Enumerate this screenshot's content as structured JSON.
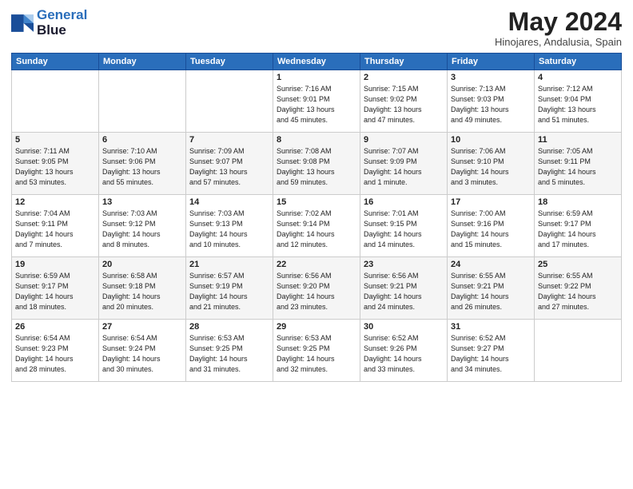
{
  "header": {
    "logo_line1": "General",
    "logo_line2": "Blue",
    "month": "May 2024",
    "location": "Hinojares, Andalusia, Spain"
  },
  "days_of_week": [
    "Sunday",
    "Monday",
    "Tuesday",
    "Wednesday",
    "Thursday",
    "Friday",
    "Saturday"
  ],
  "weeks": [
    [
      {
        "day": "",
        "info": ""
      },
      {
        "day": "",
        "info": ""
      },
      {
        "day": "",
        "info": ""
      },
      {
        "day": "1",
        "info": "Sunrise: 7:16 AM\nSunset: 9:01 PM\nDaylight: 13 hours\nand 45 minutes."
      },
      {
        "day": "2",
        "info": "Sunrise: 7:15 AM\nSunset: 9:02 PM\nDaylight: 13 hours\nand 47 minutes."
      },
      {
        "day": "3",
        "info": "Sunrise: 7:13 AM\nSunset: 9:03 PM\nDaylight: 13 hours\nand 49 minutes."
      },
      {
        "day": "4",
        "info": "Sunrise: 7:12 AM\nSunset: 9:04 PM\nDaylight: 13 hours\nand 51 minutes."
      }
    ],
    [
      {
        "day": "5",
        "info": "Sunrise: 7:11 AM\nSunset: 9:05 PM\nDaylight: 13 hours\nand 53 minutes."
      },
      {
        "day": "6",
        "info": "Sunrise: 7:10 AM\nSunset: 9:06 PM\nDaylight: 13 hours\nand 55 minutes."
      },
      {
        "day": "7",
        "info": "Sunrise: 7:09 AM\nSunset: 9:07 PM\nDaylight: 13 hours\nand 57 minutes."
      },
      {
        "day": "8",
        "info": "Sunrise: 7:08 AM\nSunset: 9:08 PM\nDaylight: 13 hours\nand 59 minutes."
      },
      {
        "day": "9",
        "info": "Sunrise: 7:07 AM\nSunset: 9:09 PM\nDaylight: 14 hours\nand 1 minute."
      },
      {
        "day": "10",
        "info": "Sunrise: 7:06 AM\nSunset: 9:10 PM\nDaylight: 14 hours\nand 3 minutes."
      },
      {
        "day": "11",
        "info": "Sunrise: 7:05 AM\nSunset: 9:11 PM\nDaylight: 14 hours\nand 5 minutes."
      }
    ],
    [
      {
        "day": "12",
        "info": "Sunrise: 7:04 AM\nSunset: 9:11 PM\nDaylight: 14 hours\nand 7 minutes."
      },
      {
        "day": "13",
        "info": "Sunrise: 7:03 AM\nSunset: 9:12 PM\nDaylight: 14 hours\nand 8 minutes."
      },
      {
        "day": "14",
        "info": "Sunrise: 7:03 AM\nSunset: 9:13 PM\nDaylight: 14 hours\nand 10 minutes."
      },
      {
        "day": "15",
        "info": "Sunrise: 7:02 AM\nSunset: 9:14 PM\nDaylight: 14 hours\nand 12 minutes."
      },
      {
        "day": "16",
        "info": "Sunrise: 7:01 AM\nSunset: 9:15 PM\nDaylight: 14 hours\nand 14 minutes."
      },
      {
        "day": "17",
        "info": "Sunrise: 7:00 AM\nSunset: 9:16 PM\nDaylight: 14 hours\nand 15 minutes."
      },
      {
        "day": "18",
        "info": "Sunrise: 6:59 AM\nSunset: 9:17 PM\nDaylight: 14 hours\nand 17 minutes."
      }
    ],
    [
      {
        "day": "19",
        "info": "Sunrise: 6:59 AM\nSunset: 9:17 PM\nDaylight: 14 hours\nand 18 minutes."
      },
      {
        "day": "20",
        "info": "Sunrise: 6:58 AM\nSunset: 9:18 PM\nDaylight: 14 hours\nand 20 minutes."
      },
      {
        "day": "21",
        "info": "Sunrise: 6:57 AM\nSunset: 9:19 PM\nDaylight: 14 hours\nand 21 minutes."
      },
      {
        "day": "22",
        "info": "Sunrise: 6:56 AM\nSunset: 9:20 PM\nDaylight: 14 hours\nand 23 minutes."
      },
      {
        "day": "23",
        "info": "Sunrise: 6:56 AM\nSunset: 9:21 PM\nDaylight: 14 hours\nand 24 minutes."
      },
      {
        "day": "24",
        "info": "Sunrise: 6:55 AM\nSunset: 9:21 PM\nDaylight: 14 hours\nand 26 minutes."
      },
      {
        "day": "25",
        "info": "Sunrise: 6:55 AM\nSunset: 9:22 PM\nDaylight: 14 hours\nand 27 minutes."
      }
    ],
    [
      {
        "day": "26",
        "info": "Sunrise: 6:54 AM\nSunset: 9:23 PM\nDaylight: 14 hours\nand 28 minutes."
      },
      {
        "day": "27",
        "info": "Sunrise: 6:54 AM\nSunset: 9:24 PM\nDaylight: 14 hours\nand 30 minutes."
      },
      {
        "day": "28",
        "info": "Sunrise: 6:53 AM\nSunset: 9:25 PM\nDaylight: 14 hours\nand 31 minutes."
      },
      {
        "day": "29",
        "info": "Sunrise: 6:53 AM\nSunset: 9:25 PM\nDaylight: 14 hours\nand 32 minutes."
      },
      {
        "day": "30",
        "info": "Sunrise: 6:52 AM\nSunset: 9:26 PM\nDaylight: 14 hours\nand 33 minutes."
      },
      {
        "day": "31",
        "info": "Sunrise: 6:52 AM\nSunset: 9:27 PM\nDaylight: 14 hours\nand 34 minutes."
      },
      {
        "day": "",
        "info": ""
      }
    ]
  ]
}
